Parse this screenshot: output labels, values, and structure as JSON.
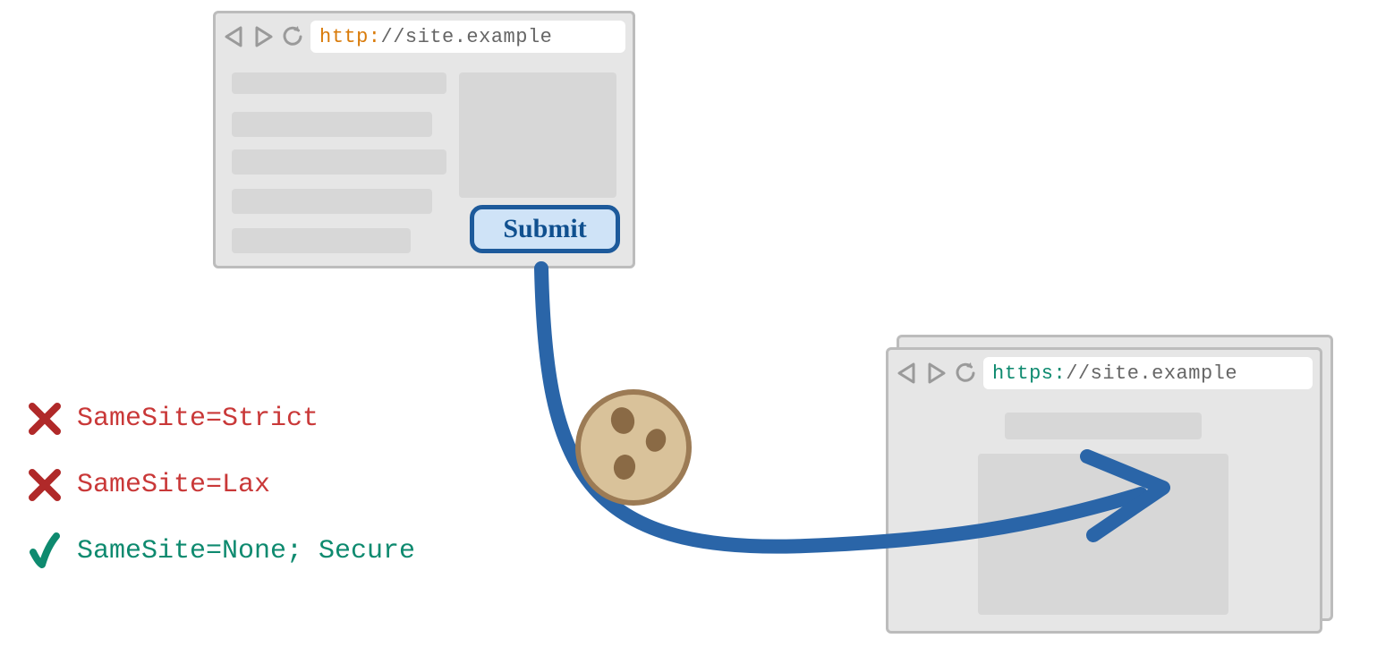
{
  "browser_a": {
    "url_scheme": "http:",
    "url_rest": "//site.example",
    "submit_label": "Submit"
  },
  "browser_b": {
    "url_scheme": "https:",
    "url_rest": "//site.example"
  },
  "legend": {
    "strict": "SameSite=Strict",
    "lax": "SameSite=Lax",
    "none": "SameSite=None; Secure"
  },
  "icons": {
    "back": "back-triangle-icon",
    "forward": "forward-triangle-icon",
    "refresh": "refresh-icon",
    "cookie": "cookie-icon",
    "cross": "x-mark-icon",
    "check": "check-mark-icon"
  }
}
